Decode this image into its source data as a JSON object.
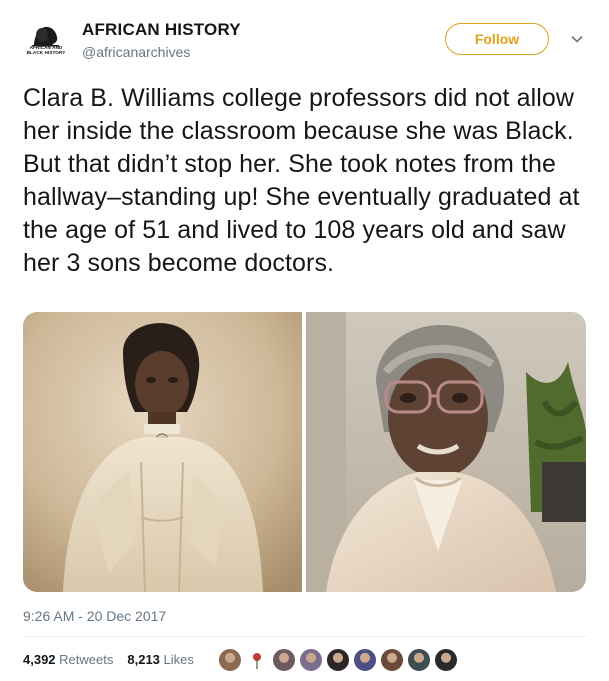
{
  "account": {
    "display_name": "AFRICAN HISTORY",
    "handle": "@africanarchives",
    "avatar_text": "AFRICAN AND BLACK HISTORY",
    "follow_label": "Follow"
  },
  "tweet": {
    "text": "Clara B. Williams college professors did not allow her inside the classroom because she was Black. But that didn’t stop her. She took notes from the hallway–standing up! She eventually graduated at the age of 51 and lived to 108 years old  and saw her 3 sons become doctors.",
    "timestamp": "9:26 AM - 20 Dec 2017"
  },
  "stats": {
    "retweets_count": "4,392",
    "retweets_label": "Retweets",
    "likes_count": "8,213",
    "likes_label": "Likes"
  },
  "media": [
    {
      "icon": "vintage-portrait-photo"
    },
    {
      "icon": "elderly-woman-portrait-photo"
    }
  ],
  "likers": [
    {
      "icon": "avatar-1",
      "color": "#8a6a52"
    },
    {
      "icon": "avatar-rose",
      "color": "#c23b3b"
    },
    {
      "icon": "avatar-3",
      "color": "#6b5a60"
    },
    {
      "icon": "avatar-4",
      "color": "#7a6d8e"
    },
    {
      "icon": "avatar-5",
      "color": "#2d2627"
    },
    {
      "icon": "avatar-6",
      "color": "#4b4f83"
    },
    {
      "icon": "avatar-7",
      "color": "#6a4a3a"
    },
    {
      "icon": "avatar-8",
      "color": "#3f4d52"
    },
    {
      "icon": "avatar-9",
      "color": "#2a2a2a"
    }
  ],
  "colors": {
    "follow_accent": "#e4a11b",
    "secondary_text": "#657786",
    "primary_text": "#14171a"
  }
}
